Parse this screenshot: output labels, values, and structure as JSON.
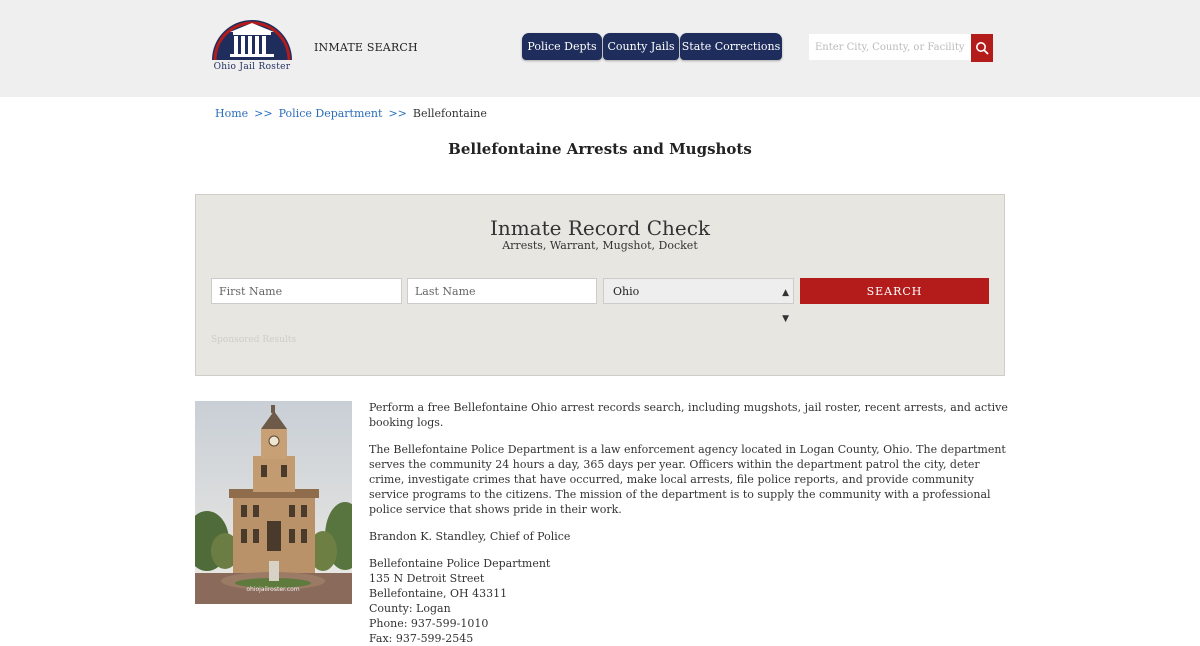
{
  "header": {
    "logo_text": "Ohio Jail Roster",
    "inmate_search_label": "INMATE SEARCH",
    "nav": [
      "Police Depts",
      "County Jails",
      "State Corrections"
    ],
    "search_placeholder": "Enter City, County, or Facility"
  },
  "breadcrumb": {
    "home": "Home",
    "sep": ">>",
    "section": "Police Department",
    "current": "Bellefontaine"
  },
  "page_title": "Bellefontaine Arrests and Mugshots",
  "record_check": {
    "title": "Inmate Record Check",
    "subtitle": "Arrests, Warrant, Mugshot, Docket",
    "first_name_placeholder": "First Name",
    "last_name_placeholder": "Last Name",
    "state_value": "Ohio",
    "search_button": "SEARCH",
    "sponsored": "Sponsored Results"
  },
  "content": {
    "intro": "Perform a free Bellefontaine Ohio arrest records search, including mugshots, jail roster, recent arrests, and active booking logs.",
    "description": "The Bellefontaine Police Department is a law enforcement agency located in Logan County, Ohio. The department serves the community 24 hours a day, 365 days per year. Officers within the department patrol the city, deter crime, investigate crimes that have occurred, make local arrests, file police reports, and provide community service programs to the citizens. The mission of the department is to supply the community with a professional police service that shows pride in their work.",
    "chief": "Brandon K. Standley, Chief of Police",
    "address_lines": [
      "Bellefontaine Police Department",
      "135 N Detroit Street",
      "Bellefontaine, OH 43311",
      "County: Logan",
      "Phone: 937-599-1010",
      "Fax: 937-599-2545"
    ],
    "watermark": "ohiojailroster.com"
  }
}
